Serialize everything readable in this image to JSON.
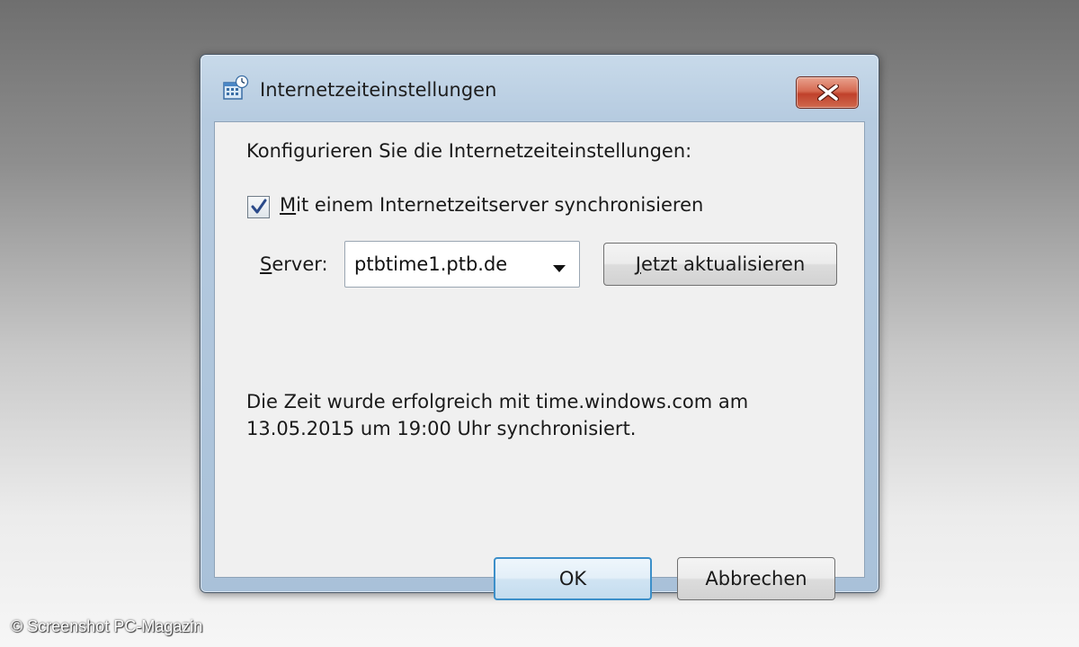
{
  "window": {
    "title": "Internetzeiteinstellungen",
    "app_icon": "calendar-clock-icon",
    "close_icon": "close-icon"
  },
  "dialog": {
    "heading": "Konfigurieren Sie die Internetzeiteinstellungen:",
    "sync_checkbox": {
      "checked": true,
      "label_mnemonic": "M",
      "label_rest": "it einem Internetzeitserver synchronisieren"
    },
    "server": {
      "label_mnemonic": "S",
      "label_rest": "erver:",
      "value": "ptbtime1.ptb.de",
      "dropdown_icon": "chevron-down-icon"
    },
    "update_button": {
      "label_mnemonic": "J",
      "label_rest": "etzt aktualisieren"
    },
    "status_line1": "Die Zeit wurde erfolgreich mit time.windows.com am",
    "status_line2": "13.05.2015 um 19:00 Uhr synchronisiert.",
    "ok_label": "OK",
    "cancel_label": "Abbrechen"
  },
  "credit": "© Screenshot PC-Magazin",
  "colors": {
    "close_button": "#c0412b",
    "default_button_border": "#3c8fc9",
    "checkmark": "#2a4a8a"
  }
}
